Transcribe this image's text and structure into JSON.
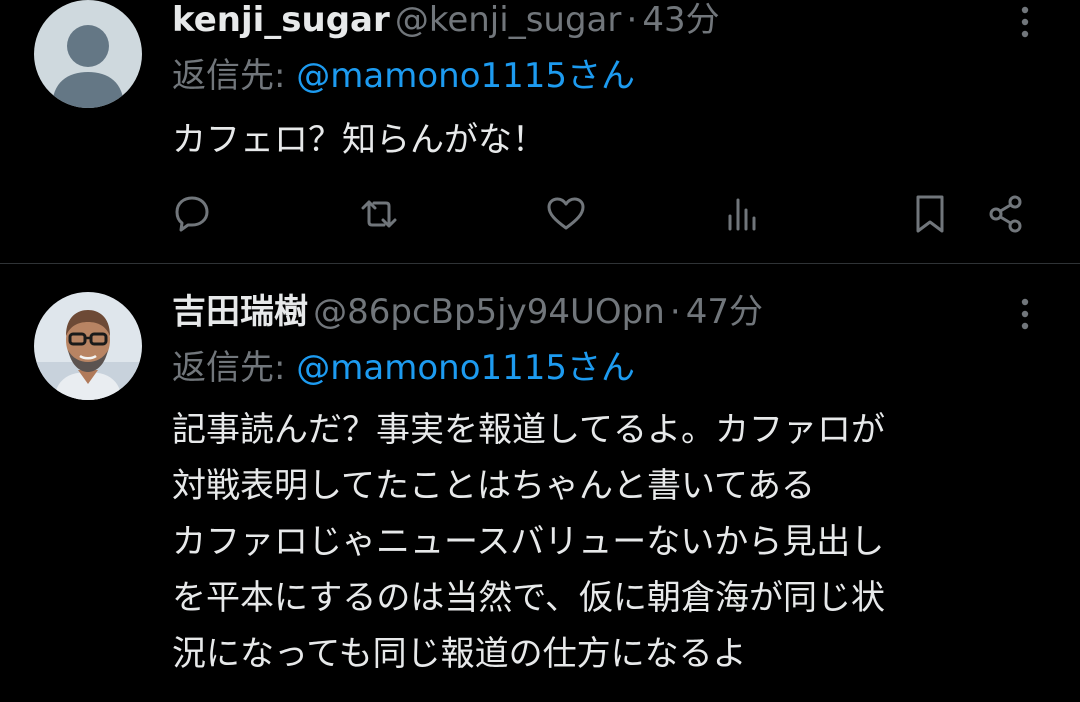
{
  "colors": {
    "background": "#000000",
    "text_primary": "#e7e9ea",
    "text_secondary": "#71767b",
    "accent_link": "#1d9bf0",
    "divider": "#2f3336"
  },
  "tweets": [
    {
      "display_name": "kenji_sugar",
      "handle": "@kenji_sugar",
      "separator": "·",
      "time": "43分",
      "reply_prefix": "返信先: ",
      "reply_to": "@mamono1115さん",
      "text": "カフェロ？知らんがな！",
      "avatar_icon": "default-avatar-icon",
      "actions": [
        "reply-icon",
        "retweet-icon",
        "like-icon",
        "views-icon",
        "bookmark-icon",
        "share-icon"
      ]
    },
    {
      "display_name": "吉田瑞樹",
      "handle": "@86pcBp5jy94UOpn",
      "separator": "·",
      "time": "47分",
      "reply_prefix": "返信先: ",
      "reply_to": "@mamono1115さん",
      "text": "記事読んだ？事実を報道してるよ。カファロが\n対戦表明してたことはちゃんと書いてある\nカファロじゃニュースバリューないから見出し\nを平本にするのは当然で、仮に朝倉海が同じ状\n況になっても同じ報道の仕方になるよ",
      "avatar_icon": "profile-photo-avatar"
    }
  ]
}
